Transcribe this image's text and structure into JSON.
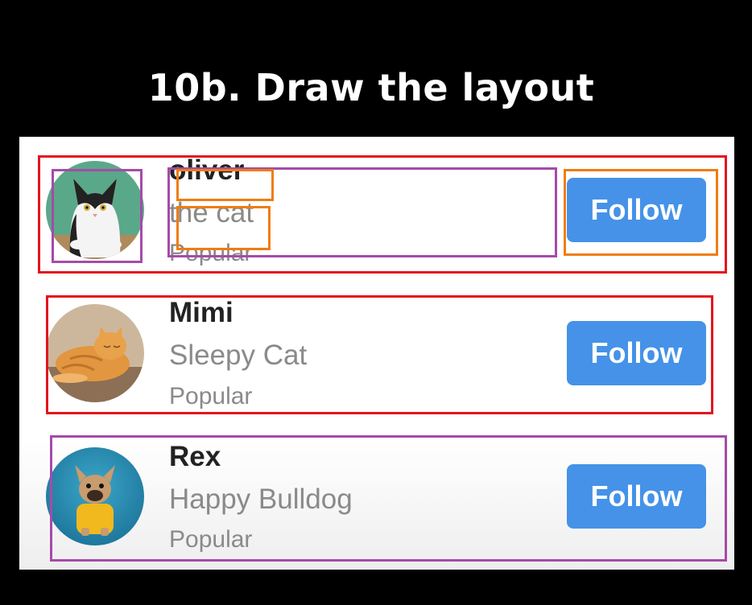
{
  "slide": {
    "title": "10b. Draw the layout"
  },
  "users": [
    {
      "name": "oliver",
      "subtitle": "the cat",
      "tag": "Popular",
      "button": "Follow"
    },
    {
      "name": "Mimi",
      "subtitle": "Sleepy Cat",
      "tag": "Popular",
      "button": "Follow"
    },
    {
      "name": "Rex",
      "subtitle": "Happy Bulldog",
      "tag": "Popular",
      "button": "Follow"
    }
  ],
  "colors": {
    "follow_button": "#4592e8",
    "annotation_red": "#e3141d",
    "annotation_purple": "#a54ba8",
    "annotation_orange": "#ef7d12"
  }
}
